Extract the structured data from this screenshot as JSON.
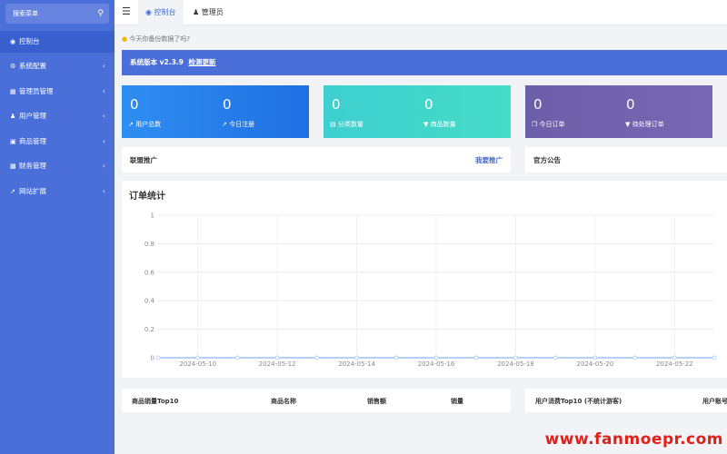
{
  "sidebar": {
    "search_placeholder": "搜索菜单",
    "items": [
      {
        "label": "控制台",
        "icon": "dashboard-icon"
      },
      {
        "label": "系统配置",
        "icon": "gears-icon"
      },
      {
        "label": "管理员管理",
        "icon": "table-icon"
      },
      {
        "label": "用户管理",
        "icon": "user-icon"
      },
      {
        "label": "商品管理",
        "icon": "cart-icon"
      },
      {
        "label": "财务管理",
        "icon": "wallet-icon"
      },
      {
        "label": "网站扩展",
        "icon": "external-link-icon"
      }
    ]
  },
  "tabs": [
    {
      "label": "控制台",
      "icon": "dashboard-icon"
    },
    {
      "label": "管理员",
      "icon": "user-icon"
    }
  ],
  "tip": "今天你备份数据了吗?",
  "version": {
    "text": "系统版本 v2.3.9",
    "link": "检测更新"
  },
  "cards": [
    {
      "stats": [
        {
          "value": "0",
          "label": "用户总数"
        },
        {
          "value": "0",
          "label": "今日注册"
        }
      ]
    },
    {
      "stats": [
        {
          "value": "0",
          "label": "分类数量"
        },
        {
          "value": "0",
          "label": "商品数量"
        }
      ]
    },
    {
      "stats": [
        {
          "value": "0",
          "label": "今日订单"
        },
        {
          "value": "0",
          "label": "待处理订单"
        }
      ]
    }
  ],
  "alliance": {
    "title": "联盟推广",
    "link": "我要推广"
  },
  "announcement": {
    "title": "官方公告"
  },
  "chart_data": {
    "type": "line",
    "title": "订单统计",
    "x": [
      "2024-05-09",
      "2024-05-10",
      "2024-05-11",
      "2024-05-12",
      "2024-05-13",
      "2024-05-14",
      "2024-05-15",
      "2024-05-16",
      "2024-05-17",
      "2024-05-18",
      "2024-05-19",
      "2024-05-20",
      "2024-05-21",
      "2024-05-22",
      "2024-05-23"
    ],
    "x_tick_labels": [
      "2024-05-10",
      "2024-05-12",
      "2024-05-14",
      "2024-05-16",
      "2024-05-18",
      "2024-05-20",
      "2024-05-22"
    ],
    "y_tick_labels": [
      "0",
      "0.2",
      "0.4",
      "0.6",
      "0.8",
      "1"
    ],
    "ylim": [
      0,
      1
    ],
    "series": [
      {
        "values": [
          0,
          0,
          0,
          0,
          0,
          0,
          0,
          0,
          0,
          0,
          0,
          0,
          0,
          0,
          0
        ]
      }
    ],
    "grid": true
  },
  "sales_table": {
    "title": "商品销量Top10",
    "headers": [
      "商品名称",
      "销售额",
      "销量"
    ]
  },
  "consume_table": {
    "title": "用户消费Top10 (不统计游客)",
    "headers": [
      "用户账号"
    ]
  },
  "watermark": "www.fanmoepr.com",
  "colors": {
    "sidebar": "#4a6fd8",
    "accent": "#3f6ad8",
    "card_blue": "#2e8bf0",
    "card_teal": "#3fd1cc",
    "card_purple": "#6c60a8"
  }
}
